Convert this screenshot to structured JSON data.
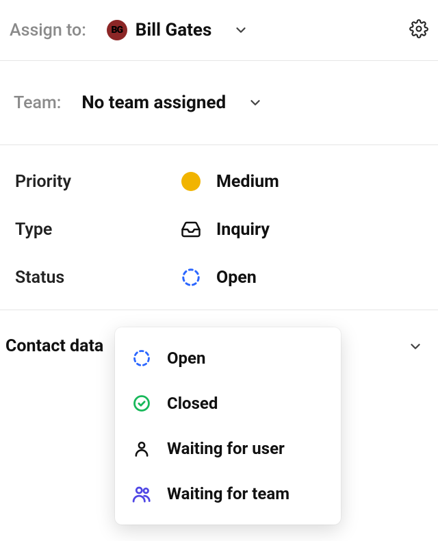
{
  "assign": {
    "label": "Assign to:",
    "person": "Bill Gates",
    "avatar_initials": "BG"
  },
  "team": {
    "label": "Team:",
    "value": "No team assigned"
  },
  "details": {
    "priority": {
      "label": "Priority",
      "value": "Medium",
      "dot_color": "#f1b400"
    },
    "type": {
      "label": "Type",
      "value": "Inquiry"
    },
    "status": {
      "label": "Status",
      "value": "Open"
    }
  },
  "contact": {
    "heading": "Contact data"
  },
  "status_dropdown": {
    "options": [
      {
        "kind": "open",
        "label": "Open"
      },
      {
        "kind": "closed",
        "label": "Closed"
      },
      {
        "kind": "user",
        "label": "Waiting for user"
      },
      {
        "kind": "team",
        "label": "Waiting for team"
      }
    ]
  },
  "colors": {
    "open_ring": "#2b66ff",
    "closed_ring": "#18b85a",
    "team_icon": "#4f46e5"
  }
}
